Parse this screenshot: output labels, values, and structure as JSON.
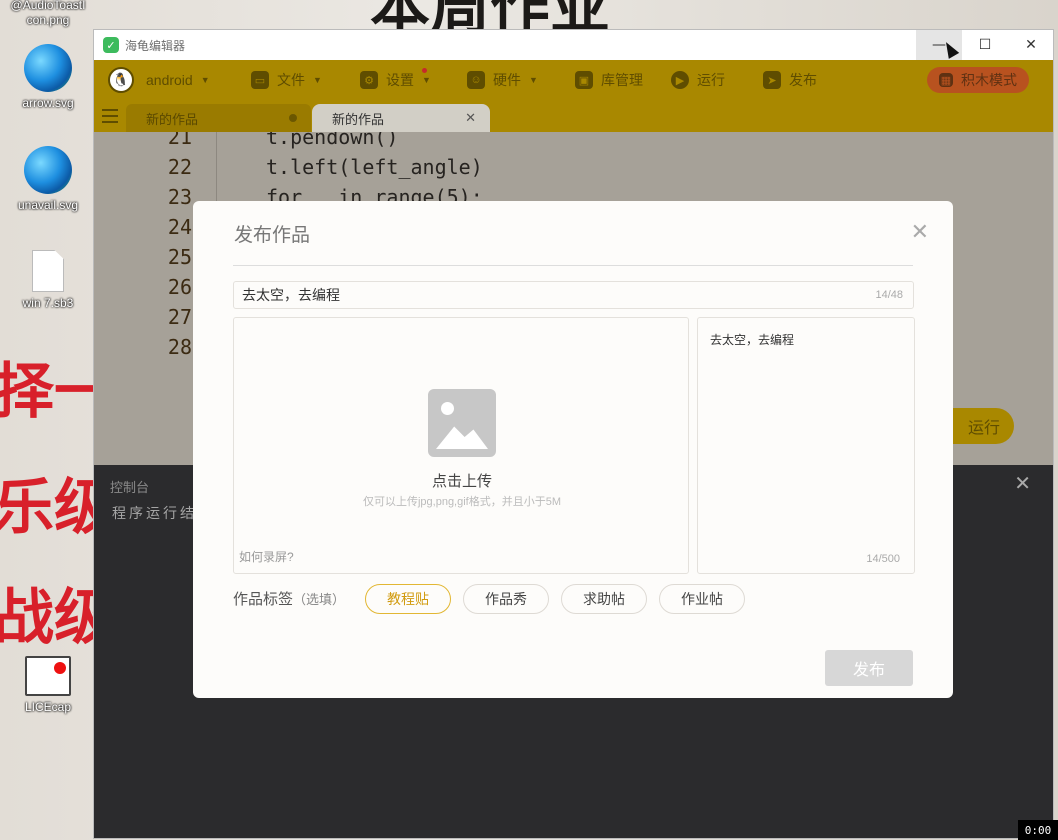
{
  "desktop": {
    "background_text": [
      "本周作业",
      "择一",
      "乐级",
      "战级"
    ],
    "icons": [
      {
        "label": "@AudioToastIcon.png"
      },
      {
        "label": "arrow.svg"
      },
      {
        "label": "unavail.svg"
      },
      {
        "label": "win 7.sb3"
      },
      {
        "label": "LICEcap"
      }
    ]
  },
  "window": {
    "title": "海龟编辑器",
    "controls": {
      "minimize": "—",
      "maximize": "☐",
      "close": "✕"
    }
  },
  "toolbar": {
    "user": "android",
    "file": "文件",
    "settings": "设置",
    "hardware": "硬件",
    "library": "库管理",
    "run": "运行",
    "publish": "发布",
    "block_mode": "积木模式"
  },
  "tabs": [
    {
      "label": "新的作品"
    },
    {
      "label": "新的作品"
    }
  ],
  "editor": {
    "lines": [
      {
        "num": "21",
        "code": "t.pendown()"
      },
      {
        "num": "22",
        "code": "t.left(left_angle)"
      },
      {
        "num": "23",
        "code": "for _ in range(5):"
      },
      {
        "num": "24",
        "code": ""
      },
      {
        "num": "25",
        "code": ""
      },
      {
        "num": "26",
        "code": ""
      },
      {
        "num": "27",
        "code": ""
      },
      {
        "num": "28",
        "code": ""
      }
    ],
    "run_button": "运行"
  },
  "console": {
    "title": "控制台",
    "output": "程序运行结"
  },
  "modal": {
    "title": "发布作品",
    "title_value": "去太空，去编程",
    "title_count": "14/48",
    "upload_text": "点击上传",
    "upload_hint": "仅可以上传jpg,png,gif格式，并且小于5M",
    "record_link": "如何录屏?",
    "description": "去太空，去编程",
    "description_count": "14/500",
    "tags_label": "作品标签",
    "tags_optional": "（选填）",
    "tags": [
      "教程贴",
      "作品秀",
      "求助帖",
      "作业帖"
    ],
    "publish_button": "发布"
  },
  "recorder": {
    "time": "0:00"
  }
}
